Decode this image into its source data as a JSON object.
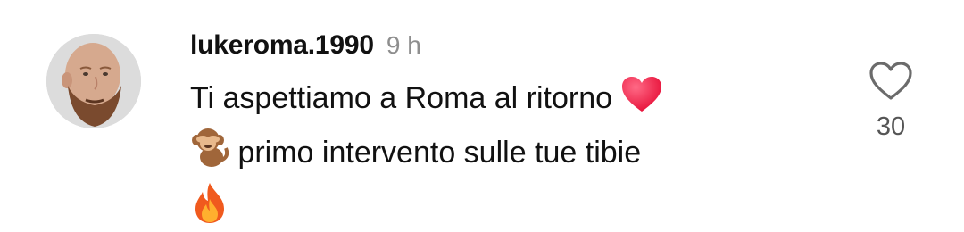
{
  "comment": {
    "username": "lukeroma.1990",
    "time_ago": "9 h",
    "lines": [
      "Ti aspettiamo a Roma al ritorno",
      "primo intervento sulle tue tibie"
    ],
    "emojis": {
      "line1_end": "red-heart-icon",
      "line2_start": "see-no-evil-monkey-icon",
      "line3": "fire-icon"
    },
    "like_count": "30",
    "like_icon": "heart-outline-icon"
  },
  "colors": {
    "text": "#111111",
    "muted": "#8e8e8e",
    "count": "#555555",
    "heart_emoji": "#f0284a"
  }
}
